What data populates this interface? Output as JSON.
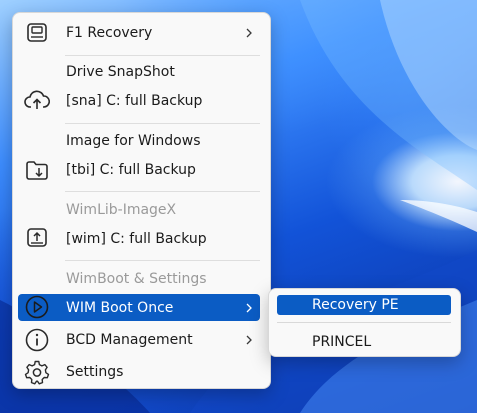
{
  "colors": {
    "accent": "#0b5cc4",
    "menu_bg": "#f9f9f9",
    "disabled_text": "#9a9a9a"
  },
  "menu": {
    "items": [
      {
        "label": "F1 Recovery",
        "icon": "drive-icon",
        "has_submenu": true
      },
      {
        "header": "Drive SnapShot",
        "label": "[sna] C: full Backup",
        "icon": "cloud-upload-icon"
      },
      {
        "header": "Image for Windows",
        "label": "[tbi] C: full Backup",
        "icon": "folder-download-icon"
      },
      {
        "header": "WimLib-ImageX",
        "label": "[wim] C: full Backup",
        "icon": "drive-upload-icon"
      },
      {
        "header": "WimBoot & Settings"
      },
      {
        "label": "WIM Boot Once",
        "icon": "play-icon",
        "has_submenu": true,
        "highlighted": true
      },
      {
        "label": "BCD Management",
        "icon": "info-icon",
        "has_submenu": true
      },
      {
        "label": "Settings",
        "icon": "gear-icon"
      }
    ]
  },
  "submenu": {
    "items": [
      {
        "label": "Recovery PE",
        "highlighted": true
      },
      {
        "label": "PRINCEL"
      }
    ]
  }
}
